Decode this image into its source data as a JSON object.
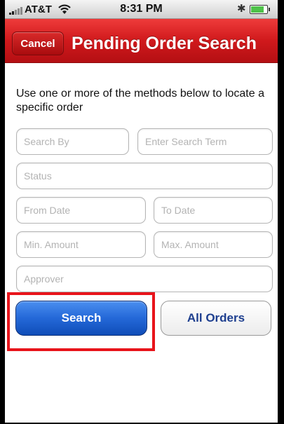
{
  "status_bar": {
    "carrier": "AT&T",
    "time": "8:31 PM"
  },
  "nav": {
    "cancel_label": "Cancel",
    "title": "Pending Order Search"
  },
  "instructions": "Use one or more of the methods below to locate a specific order",
  "fields": {
    "search_by": "Search By",
    "search_term": "Enter Search Term",
    "status": "Status",
    "from_date": "From Date",
    "to_date": "To Date",
    "min_amount": "Min. Amount",
    "max_amount": "Max. Amount",
    "approver": "Approver"
  },
  "buttons": {
    "search": "Search",
    "all_orders": "All Orders"
  },
  "colors": {
    "nav_red": "#d0191c",
    "search_blue": "#2468d8",
    "highlight_red": "#e8141b",
    "all_orders_text": "#1e3f8f"
  },
  "icons": [
    "signal-icon",
    "wifi-icon",
    "bluetooth-icon",
    "battery-icon"
  ]
}
